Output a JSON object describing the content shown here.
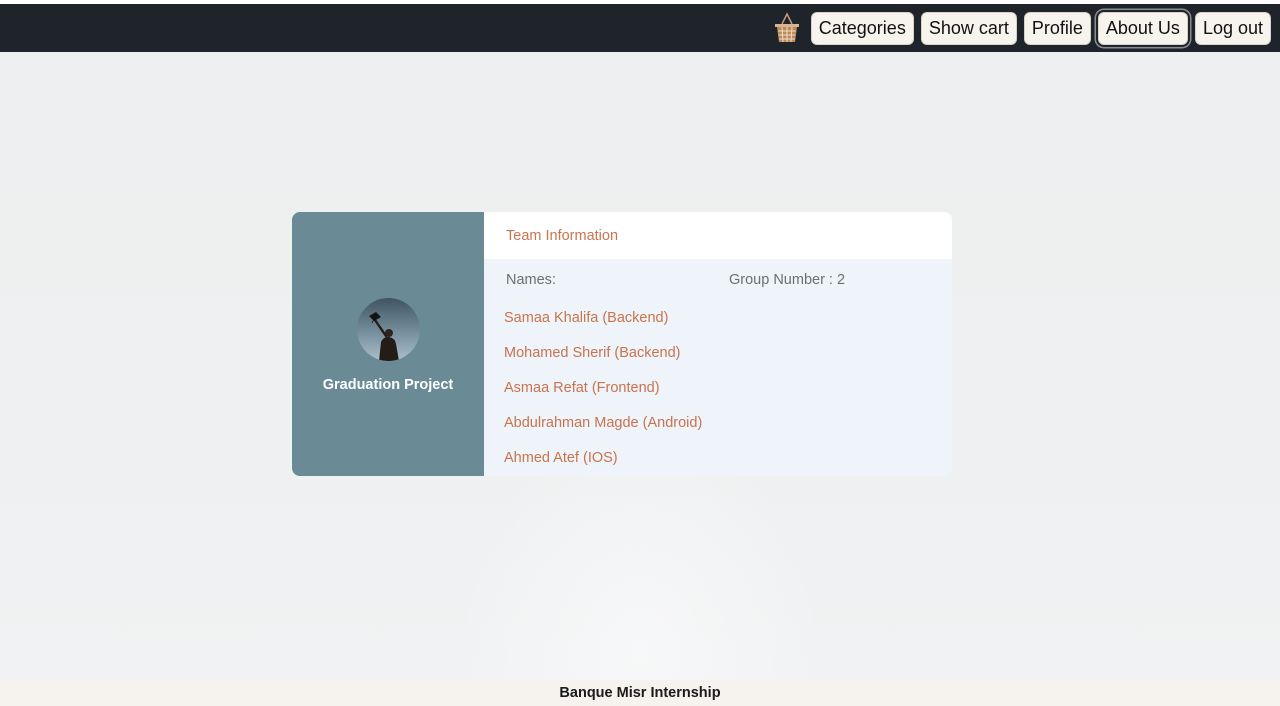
{
  "nav": {
    "cart_icon": "basket-icon",
    "buttons": [
      {
        "label": "Categories"
      },
      {
        "label": "Show cart"
      },
      {
        "label": "Profile"
      },
      {
        "label": "About Us",
        "active": true
      },
      {
        "label": "Log out"
      }
    ]
  },
  "card": {
    "left": {
      "avatar_icon": "graduation-avatar",
      "title": "Graduation Project"
    },
    "header": "Team Information",
    "names_label": "Names:",
    "group_label": "Group Number : 2",
    "members": [
      "Samaa Khalifa (Backend)",
      "Mohamed Sherif (Backend)",
      "Asmaa Refat (Frontend)",
      "Abdulrahman Magde (Android)",
      "Ahmed Atef (IOS)"
    ]
  },
  "footer": {
    "text": "Banque Misr Internship"
  },
  "colors": {
    "navbar": "#1f232a",
    "card_left": "#6a8b96",
    "accent_text": "#c8744f",
    "card_right": "#eef4f9",
    "footer": "#f6f3ee"
  }
}
